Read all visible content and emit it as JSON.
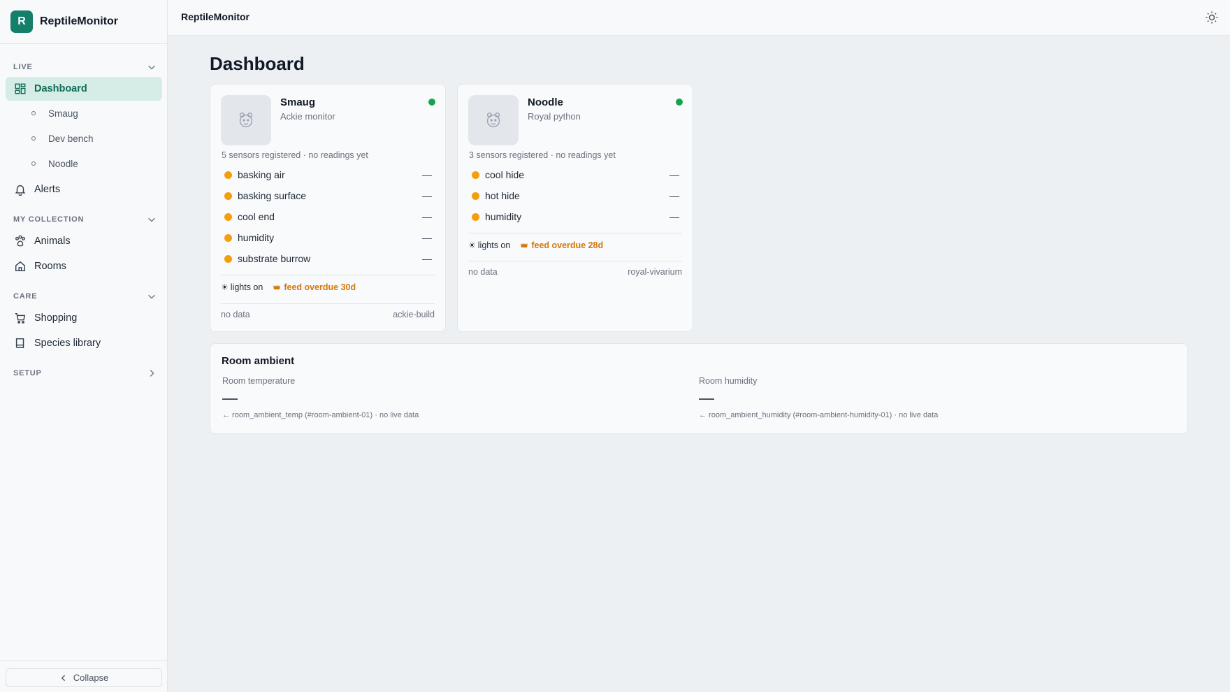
{
  "app": {
    "name": "ReptileMonitor",
    "logo_letter": "R"
  },
  "topbar": {
    "title": "ReptileMonitor"
  },
  "sidebar": {
    "sections": {
      "live": "LIVE",
      "collection": "MY COLLECTION",
      "care": "CARE",
      "setup": "SETUP"
    },
    "items": {
      "dashboard": "Dashboard",
      "alerts": "Alerts",
      "animals": "Animals",
      "rooms": "Rooms",
      "shopping": "Shopping",
      "species": "Species library"
    },
    "sub_items": [
      "Smaug",
      "Dev bench",
      "Noodle"
    ],
    "collapse": "Collapse"
  },
  "page": {
    "title": "Dashboard"
  },
  "cards": [
    {
      "name": "Smaug",
      "species": "Ackie monitor",
      "summary": "5 sensors registered · no readings yet",
      "sensors": [
        {
          "label": "basking air",
          "value": "—"
        },
        {
          "label": "basking surface",
          "value": "—"
        },
        {
          "label": "cool end",
          "value": "—"
        },
        {
          "label": "humidity",
          "value": "—"
        },
        {
          "label": "substrate burrow",
          "value": "—"
        }
      ],
      "lights": "lights on",
      "feed": "feed overdue 30d",
      "data_status": "no data",
      "enclosure": "ackie-build"
    },
    {
      "name": "Noodle",
      "species": "Royal python",
      "summary": "3 sensors registered · no readings yet",
      "sensors": [
        {
          "label": "cool hide",
          "value": "—"
        },
        {
          "label": "hot hide",
          "value": "—"
        },
        {
          "label": "humidity",
          "value": "—"
        }
      ],
      "lights": "lights on",
      "feed": "feed overdue 28d",
      "data_status": "no data",
      "enclosure": "royal-vivarium"
    }
  ],
  "ambient": {
    "title": "Room ambient",
    "temperature": {
      "label": "Room temperature",
      "source": "← room_ambient_temp (#room-ambient-01) · no live data"
    },
    "humidity": {
      "label": "Room humidity",
      "source": "← room_ambient_humidity (#room-ambient-humidity-01) · no live data"
    }
  },
  "colors": {
    "accent": "#15806a",
    "online": "#16a34a",
    "warning": "#f59e0b",
    "feed": "#d97706"
  }
}
